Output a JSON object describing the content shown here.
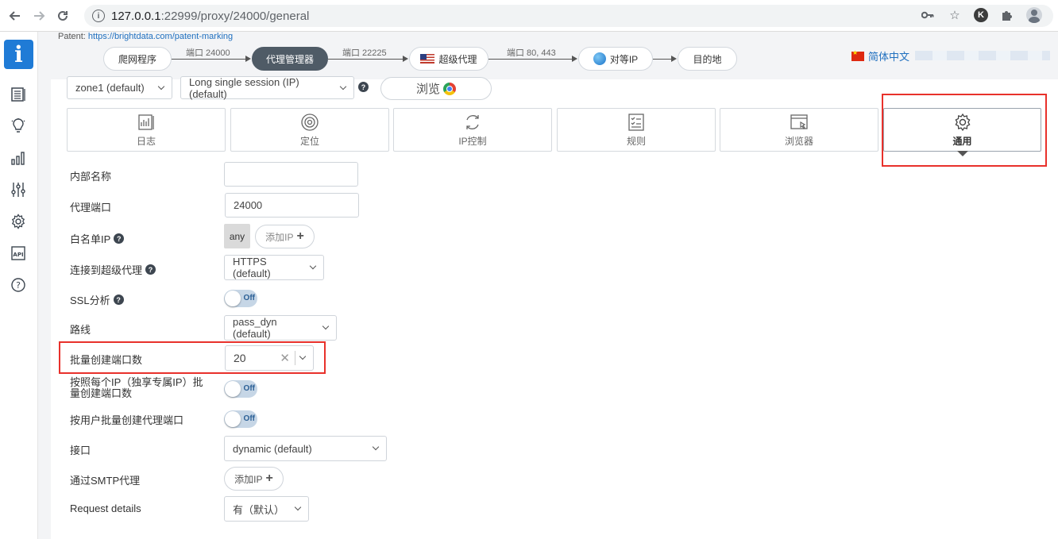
{
  "browser": {
    "url_host": "127.0.0.1",
    "url_path": ":22999/proxy/24000/general",
    "profile_initial": "K"
  },
  "sidebar": {
    "logo_glyph": "i",
    "icons": [
      "logs-icon",
      "idea-icon",
      "stats-icon",
      "sliders-icon",
      "settings-icon",
      "api-icon",
      "help-icon"
    ]
  },
  "header": {
    "patent_label": "Patent:",
    "patent_link": "https://brightdata.com/patent-marking",
    "pipeline": {
      "node1": "爬网程序",
      "link1": "端口 24000",
      "node2": "代理管理器",
      "link2": "端口 22225",
      "node3": "超级代理",
      "link3": "端口 80, 443",
      "node4": "对等IP",
      "node5": "目的地"
    },
    "language": "简体中文"
  },
  "toolbar": {
    "zone": "zone1 (default)",
    "session": "Long single session (IP) (default)",
    "browse_label": "浏览"
  },
  "tabs": [
    {
      "label": "日志",
      "icon": "logs-icon"
    },
    {
      "label": "定位",
      "icon": "target-icon"
    },
    {
      "label": "IP控制",
      "icon": "refresh-icon"
    },
    {
      "label": "规则",
      "icon": "rules-icon"
    },
    {
      "label": "浏览器",
      "icon": "browser-icon"
    },
    {
      "label": "通用",
      "icon": "gear-icon"
    }
  ],
  "form": {
    "internal_name": {
      "label": "内部名称",
      "value": ""
    },
    "proxy_port": {
      "label": "代理端口",
      "value": "24000"
    },
    "whitelist_ip": {
      "label": "白名单IP",
      "any": "any",
      "add": "添加IP"
    },
    "connect_super": {
      "label": "连接到超级代理",
      "value": "HTTPS (default)"
    },
    "ssl": {
      "label": "SSL分析",
      "state": "Off"
    },
    "route": {
      "label": "路线",
      "value": "pass_dyn (default)"
    },
    "batch_ports": {
      "label": "批量创建端口数",
      "value": "20"
    },
    "batch_per_ip": {
      "label_line1": "按照每个IP（独享专属IP）批",
      "label_line2": "量创建端口数",
      "state": "Off"
    },
    "batch_per_user": {
      "label": "按用户批量创建代理端口",
      "state": "Off"
    },
    "interface": {
      "label": "接口",
      "value": "dynamic (default)"
    },
    "smtp": {
      "label": "通过SMTP代理",
      "add": "添加IP"
    },
    "request_details": {
      "label": "Request details",
      "value": "有（默认）"
    }
  },
  "colors": {
    "accent_blue": "#1f7bd6",
    "highlight_red": "#e8312b",
    "active_node": "#4f5b66"
  }
}
